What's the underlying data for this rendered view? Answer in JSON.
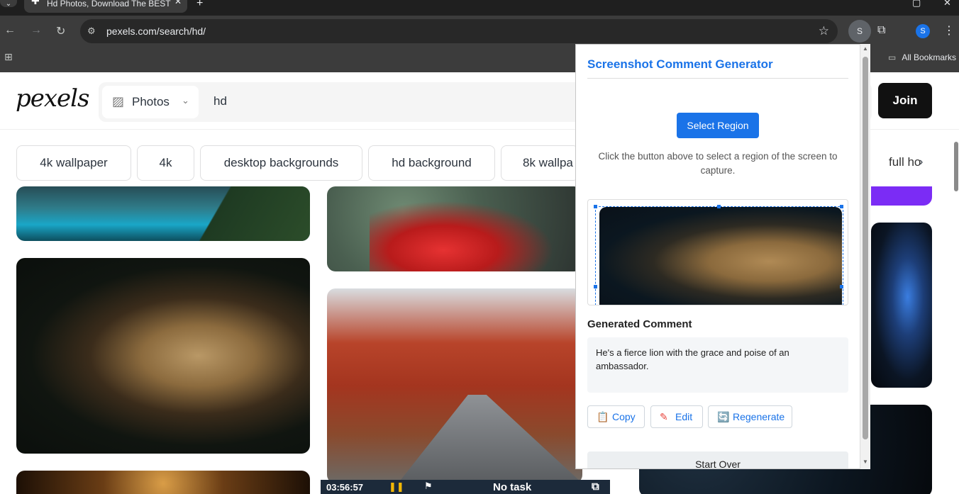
{
  "browser": {
    "tab_title": "Hd Photos, Download The BEST",
    "url": "pexels.com/search/hd/",
    "profile_initial": "S",
    "avatar_initial": "S",
    "all_bookmarks": "All Bookmarks"
  },
  "site": {
    "logo": "pexels",
    "search_type": "Photos",
    "search_query": "hd",
    "join": "Join",
    "chips": [
      "4k wallpaper",
      "4k",
      "desktop backgrounds",
      "hd background",
      "8k wallpa",
      "full ho"
    ]
  },
  "extension": {
    "title": "Screenshot Comment Generator",
    "select_region": "Select Region",
    "help": "Click the button above to select a region of the screen to capture.",
    "generated_heading": "Generated Comment",
    "generated_comment": "He's a fierce lion with the grace and poise of an ambassador.",
    "buttons": {
      "copy": "Copy",
      "edit": "Edit",
      "regenerate": "Regenerate",
      "start_over": "Start Over"
    }
  },
  "timer": {
    "time": "03:56:57",
    "task": "No task"
  },
  "icons": {
    "back": "arrow-left-icon",
    "forward": "arrow-right-icon",
    "reload": "reload-icon",
    "star": "star-icon",
    "extensions": "puzzle-icon",
    "menu": "kebab-icon"
  },
  "colors": {
    "accent": "#1a73e8",
    "join_bg": "#111111",
    "timer_bg": "#1c2a3a"
  }
}
